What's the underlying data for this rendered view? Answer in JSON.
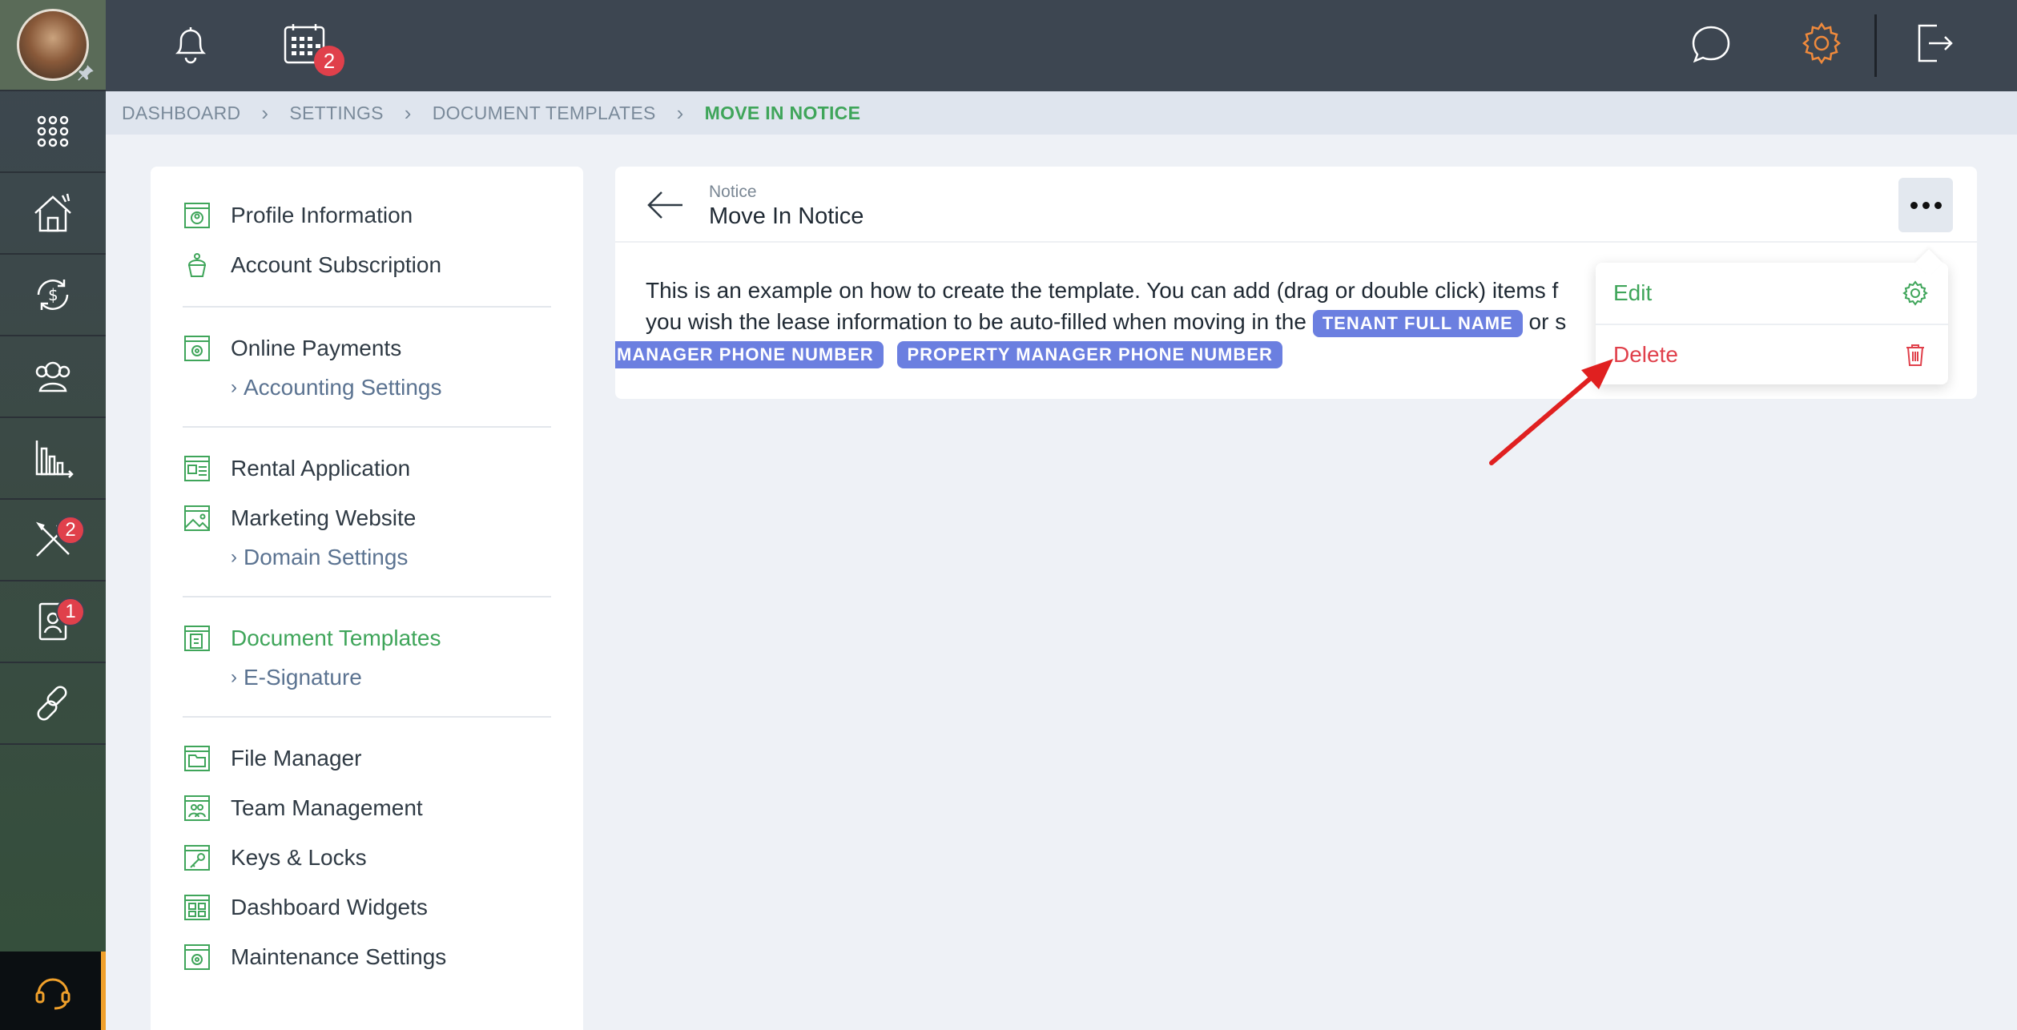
{
  "header": {
    "calendar_badge": "2"
  },
  "sidebar": {
    "badges": {
      "tools": "2",
      "contacts": "1"
    }
  },
  "breadcrumb": [
    "DASHBOARD",
    "SETTINGS",
    "DOCUMENT TEMPLATES",
    "MOVE IN NOTICE"
  ],
  "settings_menu": {
    "profile_information": "Profile Information",
    "account_subscription": "Account Subscription",
    "online_payments": "Online Payments",
    "accounting_settings": "Accounting Settings",
    "rental_application": "Rental Application",
    "marketing_website": "Marketing Website",
    "domain_settings": "Domain Settings",
    "document_templates": "Document Templates",
    "e_signature": "E-Signature",
    "file_manager": "File Manager",
    "team_management": "Team Management",
    "keys_locks": "Keys & Locks",
    "dashboard_widgets": "Dashboard Widgets",
    "maintenance_settings": "Maintenance Settings"
  },
  "template": {
    "type": "Notice",
    "title": "Move In Notice",
    "body_line1": "This is an example on how to create the template. You can add (drag or double click) items f",
    "body_line2": "you wish the lease information to be auto-filled when moving in the",
    "tag_tenant_full_name": "TENANT FULL NAME",
    "body_line2_tail": "or s",
    "tag_manager_phone": "MANAGER PHONE NUMBER",
    "tag_property_manager_phone": "PROPERTY MANAGER PHONE NUMBER"
  },
  "dropdown": {
    "edit": "Edit",
    "delete": "Delete"
  },
  "colors": {
    "accent_green": "#3fa55a",
    "danger_red": "#e0404b",
    "tag_blue": "#6b7fe0",
    "gear_orange": "#f08a3c"
  }
}
